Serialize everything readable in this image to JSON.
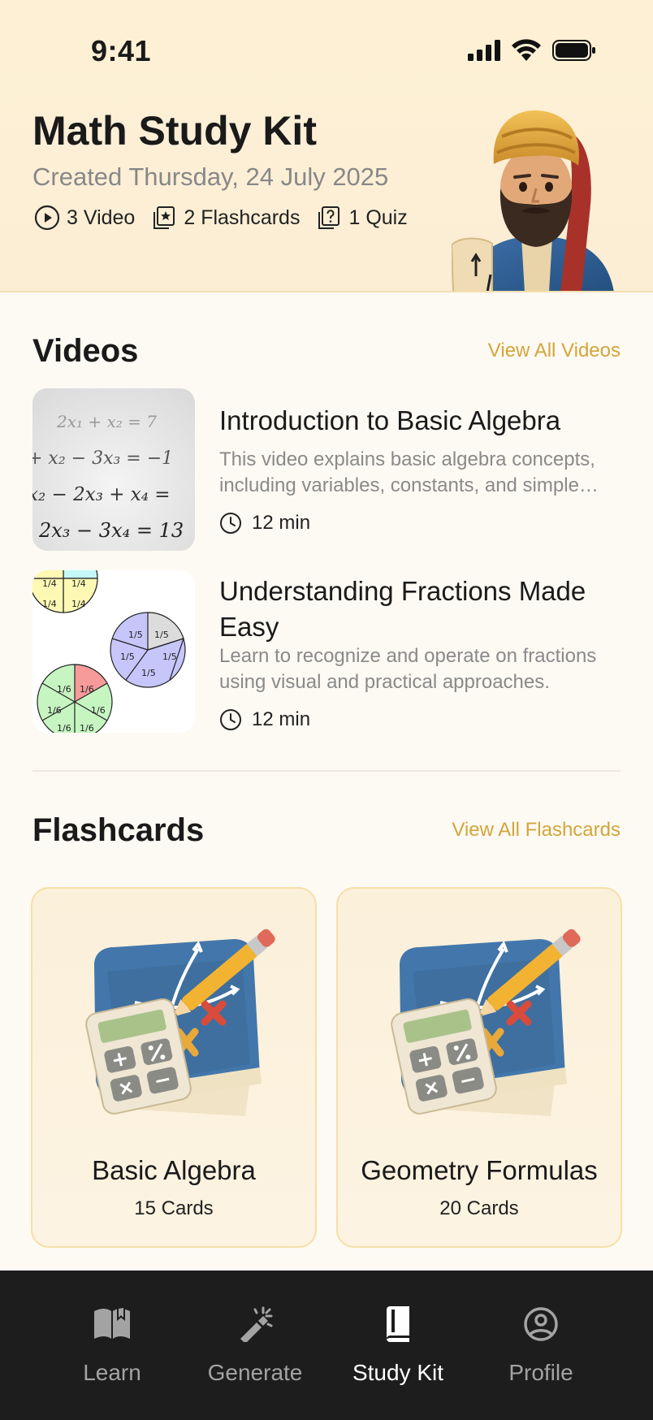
{
  "status_bar": {
    "time": "9:41"
  },
  "header": {
    "title": "Math Study Kit",
    "created": "Created Thursday,  24 July 2025",
    "stats": [
      {
        "icon": "play-circle-icon",
        "label": "3 Video"
      },
      {
        "icon": "flashcard-star-icon",
        "label": "2 Flashcards"
      },
      {
        "icon": "quiz-question-icon",
        "label": "1 Quiz"
      }
    ]
  },
  "videos": {
    "section_title": "Videos",
    "view_all": "View All Videos",
    "items": [
      {
        "title": "Introduction to Basic Algebra",
        "description": "This video explains basic algebra concepts, including variables, constants, and simple…",
        "duration": "12 min",
        "thumbnail_lines": [
          "2x₁ + x₂ = 7",
          "+ x₂ − 3x₃ = −1",
          "x₂ − 2x₃ + x₄ =",
          "2x₃ − 3x₄ = 13"
        ]
      },
      {
        "title": "Understanding Fractions Made Easy",
        "description": "Learn to recognize and operate on fractions using visual and practical approaches.",
        "duration": "12 min",
        "thumbnail_labels": {
          "quarter": "1/4",
          "fifth": "1/5",
          "sixth": "1/6"
        }
      }
    ]
  },
  "flashcards": {
    "section_title": "Flashcards",
    "view_all": "View All Flashcards",
    "items": [
      {
        "title": "Basic Algebra",
        "count": "15 Cards"
      },
      {
        "title": "Geometry Formulas",
        "count": "20 Cards"
      }
    ]
  },
  "tabbar": {
    "items": [
      {
        "label": "Learn",
        "icon": "open-book-icon"
      },
      {
        "label": "Generate",
        "icon": "magic-wand-icon"
      },
      {
        "label": "Study Kit",
        "icon": "book-icon"
      },
      {
        "label": "Profile",
        "icon": "user-circle-icon"
      }
    ],
    "active": "Study Kit"
  },
  "colors": {
    "accent": "#d3a53b",
    "header_bg": "#fdf0d4",
    "tabbar_bg": "#1d1d1d"
  }
}
